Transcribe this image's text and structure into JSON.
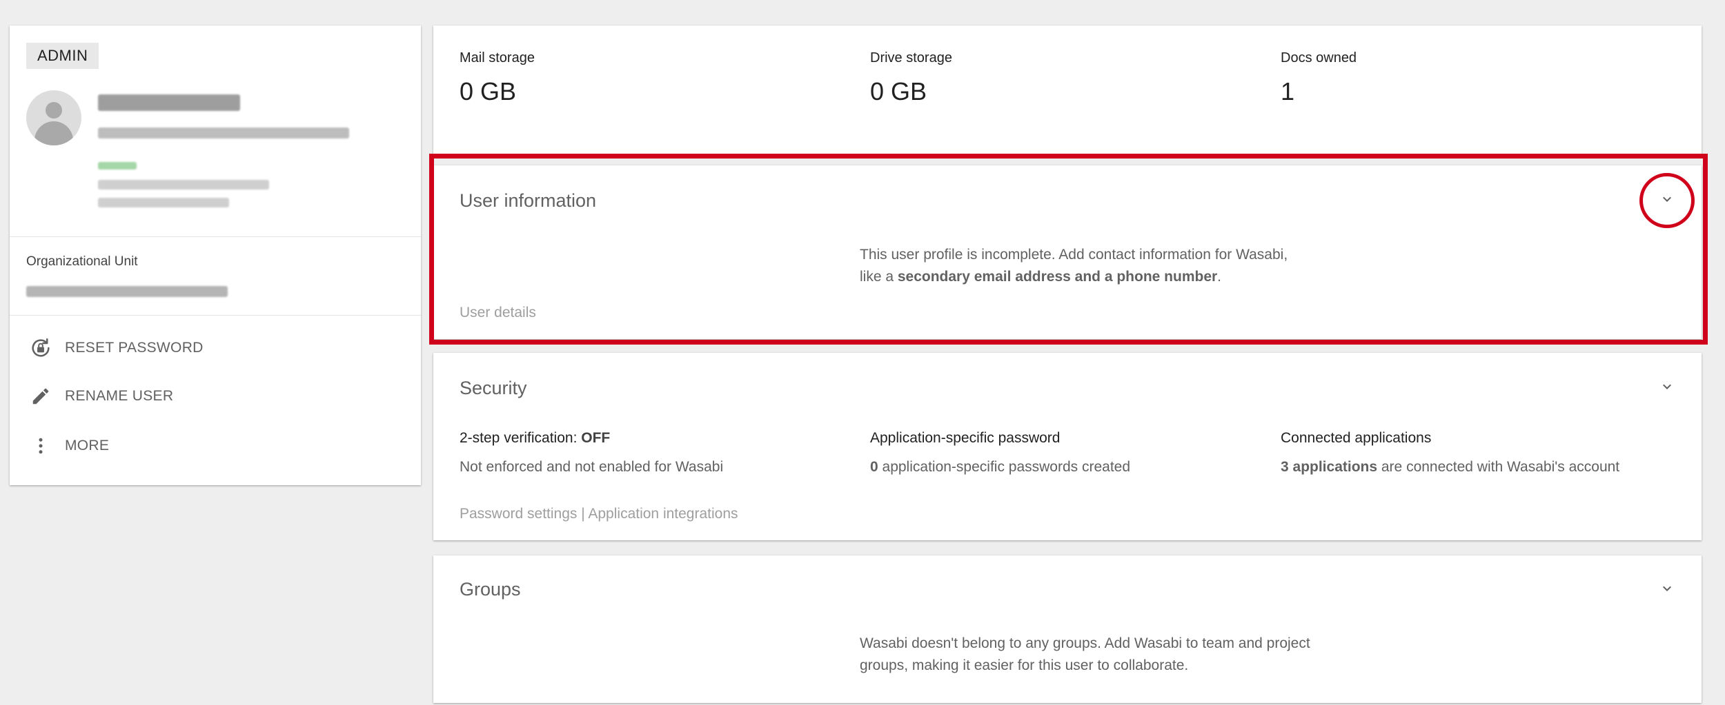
{
  "profile": {
    "role_badge": "ADMIN",
    "org_unit_label": "Organizational Unit",
    "actions": [
      {
        "label": "RESET PASSWORD",
        "icon": "lock-reset-icon"
      },
      {
        "label": "RENAME USER",
        "icon": "pencil-icon"
      },
      {
        "label": "MORE",
        "icon": "more-vert-icon"
      }
    ]
  },
  "storage": {
    "mail": {
      "label": "Mail storage",
      "value": "0 GB"
    },
    "drive": {
      "label": "Drive storage",
      "value": "0 GB"
    },
    "docs": {
      "label": "Docs owned",
      "value": "1"
    }
  },
  "user_info": {
    "title": "User information",
    "message_pre": "This user profile is incomplete. Add contact information for Wasabi, like a ",
    "message_bold": "secondary email address and a phone number",
    "message_post": ".",
    "link": "User details"
  },
  "security": {
    "title": "Security",
    "two_step_label": "2-step verification: ",
    "two_step_value": "OFF",
    "two_step_desc": "Not enforced and not enabled for Wasabi",
    "app_pw_title": "Application-specific password",
    "app_pw_count": "0",
    "app_pw_desc": " application-specific passwords created",
    "connected_title": "Connected applications",
    "connected_count": "3 applications",
    "connected_desc": " are connected with Wasabi's account",
    "links": "Password settings | Application integrations"
  },
  "groups": {
    "title": "Groups",
    "message": "Wasabi doesn't belong to any groups. Add Wasabi to team and project groups, making it easier for this user to collaborate."
  },
  "colors": {
    "highlight": "#d0021b",
    "background": "#eeeeee",
    "card": "#ffffff"
  }
}
